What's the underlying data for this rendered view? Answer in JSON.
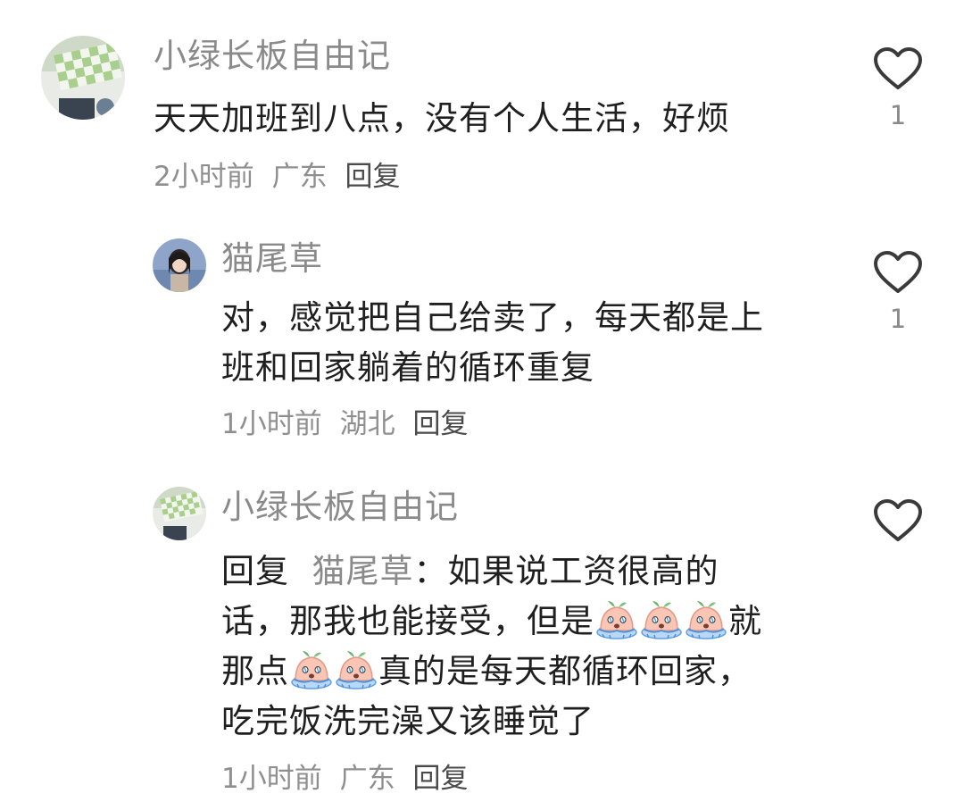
{
  "comments": [
    {
      "username": "小绿长板自由记",
      "content": "天天加班到八点，没有个人生活，好烦",
      "time": "2小时前",
      "location": "广东",
      "reply_label": "回复",
      "likes": "1",
      "like_icon": "heart-outline-icon"
    },
    {
      "username": "猫尾草",
      "content_line1": "对，感觉把自己给卖了，每天都是上",
      "content_line2": "班和回家躺着的循环重复",
      "time": "1小时前",
      "location": "湖北",
      "reply_label": "回复",
      "likes": "1",
      "like_icon": "heart-outline-icon"
    },
    {
      "username": "小绿长板自由记",
      "reply_prefix": "回复",
      "reply_target": "猫尾草",
      "line1_rest": "：如果说工资很高的",
      "line2_a": "话，那我也能接受，但是",
      "line2_b": "就",
      "line3_a": "那点",
      "line3_b": "真的是每天都循环回家，",
      "line4": "吃完饭洗完澡又该睡觉了",
      "emoji_name": "crying-peach-emoji",
      "time": "1小时前",
      "location": "广东",
      "reply_label": "回复",
      "like_icon": "heart-outline-icon"
    }
  ]
}
